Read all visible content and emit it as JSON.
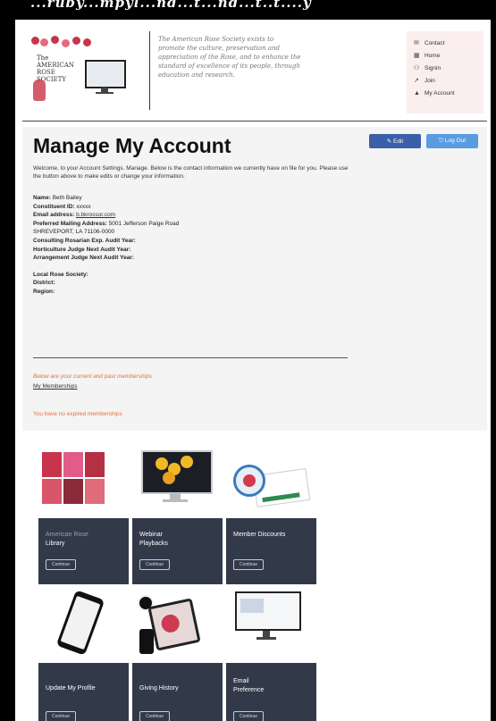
{
  "banner_text": "...ruby...mpyl...nd...t...nd...t..t....y",
  "header": {
    "logo_lines": [
      "The",
      "AMERICAN",
      "ROSE",
      "SOCIETY"
    ],
    "mission": "The American Rose Society exists to promote the culture, preservation and appreciation of the Rose, and to enhance the standard of excellence of its people, through education and research.",
    "nav": [
      {
        "icon": "✉",
        "label": "Contact"
      },
      {
        "icon": "▦",
        "label": "Home"
      },
      {
        "icon": "⚇",
        "label": "Signin"
      },
      {
        "icon": "↗",
        "label": "Join"
      },
      {
        "icon": "▲",
        "label": "My Account"
      }
    ]
  },
  "account": {
    "title": "Manage My Account",
    "edit_label": "✎ Edit",
    "logout_label": "⎋ Log Out",
    "welcome": "Welcome, to your Account Settings. Manage. Below is the contact information we currently have on file for you. Please use the button above to make edits or change your information.",
    "fields": [
      {
        "label": "Name:",
        "value": "Beth Bailey"
      },
      {
        "label": "Constituent ID:",
        "value": "xxxxx"
      },
      {
        "label": "Email address:",
        "value": "b.bkrossor.com",
        "link": true
      },
      {
        "label": "Preferred Mailing Address:",
        "value": "5001 Jefferson Paige Road"
      },
      {
        "label": "",
        "value": "SHREVEPORT, LA 71106-0000"
      },
      {
        "label": "Consulting Rosarian Exp. Audit Year:",
        "value": ""
      },
      {
        "label": "Horticulture Judge Next Audit Year:",
        "value": ""
      },
      {
        "label": "Arrangement Judge Next Audit Year:",
        "value": ""
      }
    ],
    "fields2": [
      {
        "label": "Local Rose Society:",
        "value": ""
      },
      {
        "label": "District:",
        "value": ""
      },
      {
        "label": "Region:",
        "value": ""
      }
    ],
    "renew_note": "Below are your current and past memberships",
    "memberships_link": "My Memberships",
    "no_expired": "You have no expired memberships"
  },
  "cards": [
    {
      "title_top": "American Rose",
      "title": "Library",
      "button": "Continue",
      "faded_top": true
    },
    {
      "title_top": "Webinar",
      "title": "Playbacks",
      "button": "Continue"
    },
    {
      "title_top": "",
      "title": "Member Discounts",
      "button": "Continue"
    },
    {
      "title_top": "",
      "title": "Update My Profile",
      "button": "Continue"
    },
    {
      "title_top": "",
      "title": "Giving History",
      "button": "Continue"
    },
    {
      "title_top": "Email",
      "title": "Preference",
      "button": "Continue"
    }
  ]
}
